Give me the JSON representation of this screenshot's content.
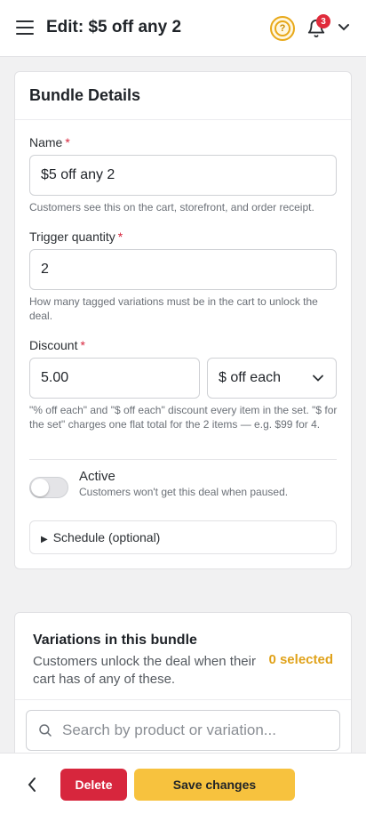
{
  "header": {
    "title": "Edit: $5 off any 2",
    "notification_count": "3",
    "help_symbol": "?"
  },
  "bundle_details": {
    "title": "Bundle Details",
    "name_label": "Name",
    "required_mark": "*",
    "name_value": "$5 off any 2",
    "name_help": "Customers see this on the cart, storefront, and order receipt.",
    "trigger_label": "Trigger quantity",
    "trigger_value": "2",
    "trigger_help": "How many tagged variations must be in the cart to unlock the deal.",
    "discount_label": "Discount",
    "discount_value": "5.00",
    "discount_type": "$ off each",
    "discount_help": "\"% off each\" and \"$ off each\" discount every item in the set. \"$ for the set\" charges one flat total for the 2 items — e.g. $99 for 4.",
    "active_label": "Active",
    "active_help": "Customers won't get this deal when paused.",
    "active_on": false,
    "schedule_label": "Schedule (optional)"
  },
  "variations": {
    "title": "Variations in this bundle",
    "subtitle": "Customers unlock the deal when their cart has of any of these.",
    "selected_label": "0 selected",
    "search_placeholder": "Search by product or variation..."
  },
  "footer": {
    "delete_label": "Delete",
    "save_label": "Save changes"
  },
  "colors": {
    "accent": "#f7c23e",
    "danger": "#d7263d",
    "warning_text": "#e0a21a"
  }
}
